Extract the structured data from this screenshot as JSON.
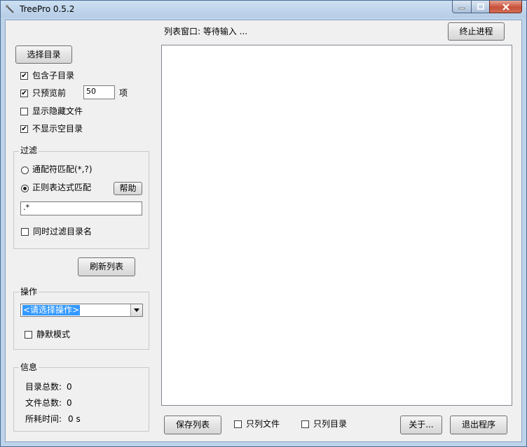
{
  "window": {
    "title": "TreePro 0.5.2"
  },
  "left_panel": {
    "select_dir_button": "选择目录",
    "include_subdirs": {
      "label": "包含子目录",
      "checked": true
    },
    "preview_only": {
      "label": "只预览前",
      "checked": true,
      "value": "50",
      "unit": "项"
    },
    "show_hidden": {
      "label": "显示隐藏文件",
      "checked": false
    },
    "hide_empty_dirs": {
      "label": "不显示空目录",
      "checked": true
    },
    "filter": {
      "title": "过滤",
      "wildcard_label": "通配符匹配(*,?)",
      "regex_label": "正则表达式匹配",
      "help_button": "帮助",
      "pattern_value": ".*",
      "filter_dirnames": {
        "label": "同时过滤目录名",
        "checked": false
      }
    },
    "refresh_button": "刷新列表",
    "operation": {
      "title": "操作",
      "selected": "<请选择操作>",
      "silent_mode": {
        "label": "静默模式",
        "checked": false
      }
    },
    "info": {
      "title": "信息",
      "dir_count_label": "目录总数:",
      "dir_count": "0",
      "file_count_label": "文件总数:",
      "file_count": "0",
      "elapsed_label": "所耗时间:",
      "elapsed": "0 s"
    }
  },
  "list": {
    "status": "列表窗口: 等待输入 ...",
    "stop_button": "终止进程"
  },
  "bottom_bar": {
    "save_button": "保存列表",
    "files_only": {
      "label": "只列文件",
      "checked": false
    },
    "dirs_only": {
      "label": "只列目录",
      "checked": false
    },
    "about_button": "关于...",
    "exit_button": "退出程序"
  },
  "check_glyph": "✔"
}
